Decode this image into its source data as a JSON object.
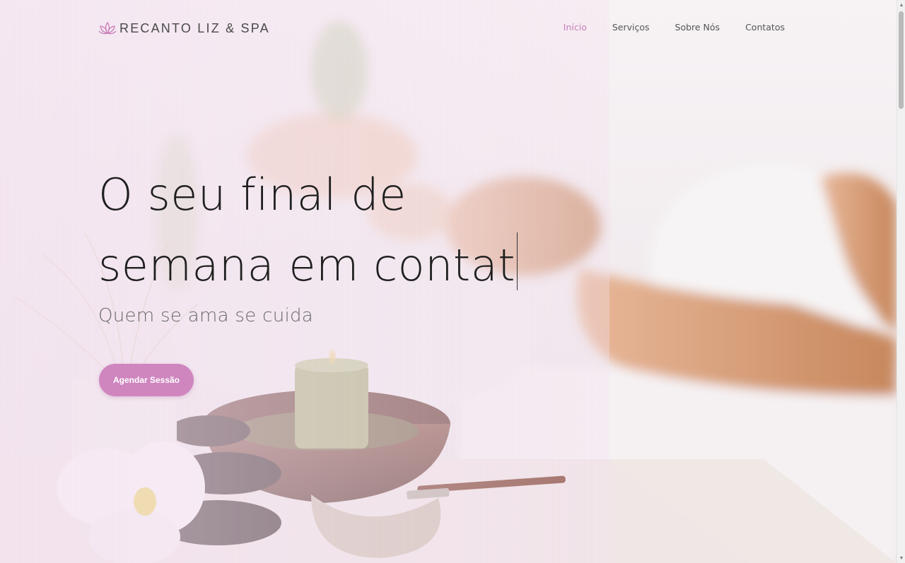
{
  "brand": {
    "name": "RECANTO LIZ & SPA",
    "icon": "lotus-icon",
    "color": "#c97cb8"
  },
  "nav": {
    "items": [
      {
        "label": "Início",
        "active": true
      },
      {
        "label": "Serviços",
        "active": false
      },
      {
        "label": "Sobre Nós",
        "active": false
      },
      {
        "label": "Contatos",
        "active": false
      }
    ]
  },
  "hero": {
    "title_line1": "O seu final de",
    "title_line2": "semana em contat",
    "subtitle": "Quem se ama se cuida",
    "cta_label": "Agendar Sessão"
  },
  "colors": {
    "accent": "#cf86bf",
    "nav_active": "#c97cb8",
    "overlay": "#f3e2f0"
  },
  "background_image": "spa-massage-photo"
}
